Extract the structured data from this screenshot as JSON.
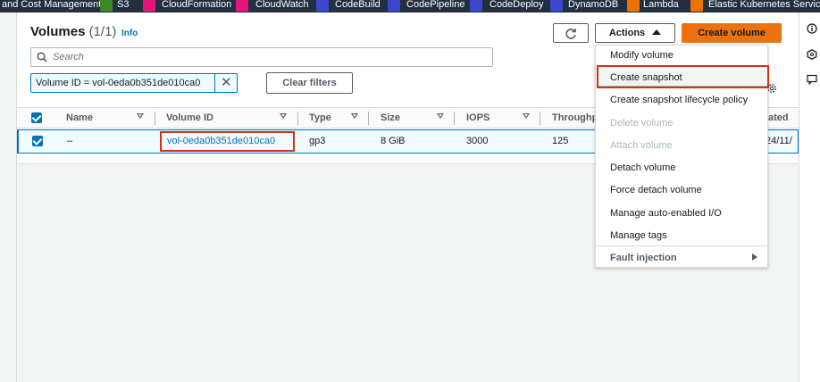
{
  "service_bar": [
    {
      "label": "and Cost Management",
      "icon": "billing-icon",
      "color": "#232f3e"
    },
    {
      "label": "S3",
      "icon": "s3-icon",
      "color": "#3f8624"
    },
    {
      "label": "CloudFormation",
      "icon": "cloudformation-icon",
      "color": "#e7157b"
    },
    {
      "label": "CloudWatch",
      "icon": "cloudwatch-icon",
      "color": "#e7157b"
    },
    {
      "label": "CodeBuild",
      "icon": "codebuild-icon",
      "color": "#3b48cc"
    },
    {
      "label": "CodePipeline",
      "icon": "codepipeline-icon",
      "color": "#3b48cc"
    },
    {
      "label": "CodeDeploy",
      "icon": "codedeploy-icon",
      "color": "#3b48cc"
    },
    {
      "label": "DynamoDB",
      "icon": "dynamodb-icon",
      "color": "#3b48cc"
    },
    {
      "label": "Lambda",
      "icon": "lambda-icon",
      "color": "#ed7100"
    },
    {
      "label": "Elastic Kubernetes Servic",
      "icon": "eks-icon",
      "color": "#ed7100"
    }
  ],
  "header": {
    "title": "Volumes",
    "count": "(1/1)",
    "info": "Info",
    "actions_label": "Actions",
    "create_label": "Create volume"
  },
  "search": {
    "placeholder": "Search"
  },
  "filter_token": {
    "text": "Volume ID = vol-0eda0b351de010ca0"
  },
  "clear_filters": "Clear filters",
  "table": {
    "columns": [
      "Name",
      "Volume ID",
      "Type",
      "Size",
      "IOPS",
      "Throughput",
      "ated"
    ],
    "rows": [
      {
        "name": "–",
        "volume_id": "vol-0eda0b351de010ca0",
        "type": "gp3",
        "size": "8 GiB",
        "iops": "3000",
        "throughput": "125",
        "created": "24/11/"
      }
    ]
  },
  "actions_menu": {
    "items": [
      {
        "label": "Modify volume",
        "disabled": false
      },
      {
        "label": "Create snapshot",
        "disabled": false,
        "highlighted": true
      },
      {
        "label": "Create snapshot lifecycle policy",
        "disabled": false
      },
      {
        "label": "Delete volume",
        "disabled": true
      },
      {
        "label": "Attach volume",
        "disabled": true
      },
      {
        "label": "Detach volume",
        "disabled": false
      },
      {
        "label": "Force detach volume",
        "disabled": false
      },
      {
        "label": "Manage auto-enabled I/O",
        "disabled": false
      },
      {
        "label": "Manage tags",
        "disabled": false
      }
    ],
    "submenu": {
      "label": "Fault injection"
    }
  },
  "colors": {
    "accent": "#0073bb",
    "primary_button": "#ec7211",
    "highlight_border": "#d13212"
  }
}
